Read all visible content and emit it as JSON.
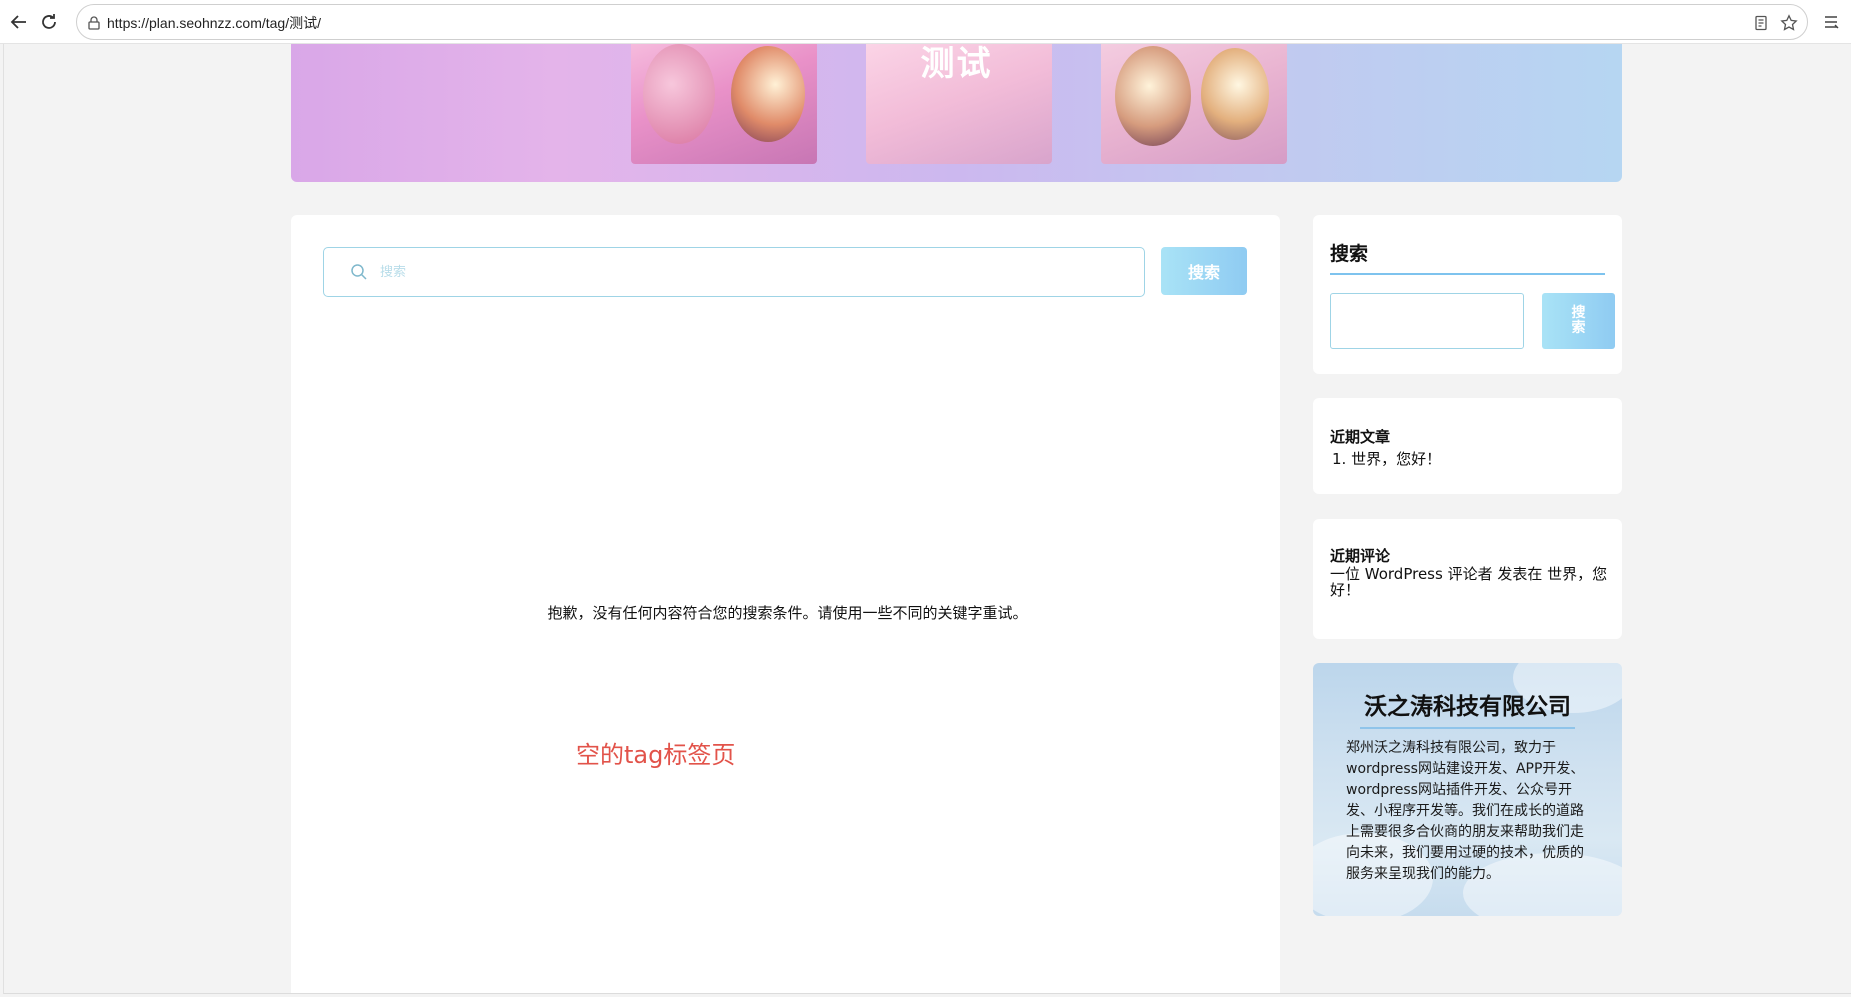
{
  "browser": {
    "url": "https://plan.seohnzz.com/tag/测试/",
    "icons": [
      "back-arrow-icon",
      "reload-icon",
      "lock-icon",
      "reader-mode-icon",
      "bookmark-star-icon",
      "menu-icon"
    ]
  },
  "banner": {
    "title": "测试"
  },
  "main": {
    "search_placeholder": "搜索",
    "search_button": "搜索",
    "no_results": "抱歉，没有任何内容符合您的搜索条件。请使用一些不同的关键字重试。",
    "annotation": "空的tag标签页"
  },
  "sidebar": {
    "search": {
      "title": "搜索",
      "button": "搜索"
    },
    "recent_posts": {
      "title": "近期文章",
      "items": [
        "1. 世界，您好！"
      ]
    },
    "recent_comments": {
      "title": "近期评论",
      "text": "一位 WordPress 评论者 发表在 世界，您好！"
    },
    "company": {
      "title": "沃之涛科技有限公司",
      "description": "郑州沃之涛科技有限公司，致力于wordpress网站建设开发、APP开发、wordpress网站插件开发、公众号开发、小程序开发等。我们在成长的道路上需要很多合伙商的朋友来帮助我们走向未来，我们要用过硬的技术，优质的服务来呈现我们的能力。"
    }
  },
  "colors": {
    "accent_blue": "#8fcbf2",
    "annotation_red": "#e2534a",
    "input_border": "#9fd4e6"
  }
}
